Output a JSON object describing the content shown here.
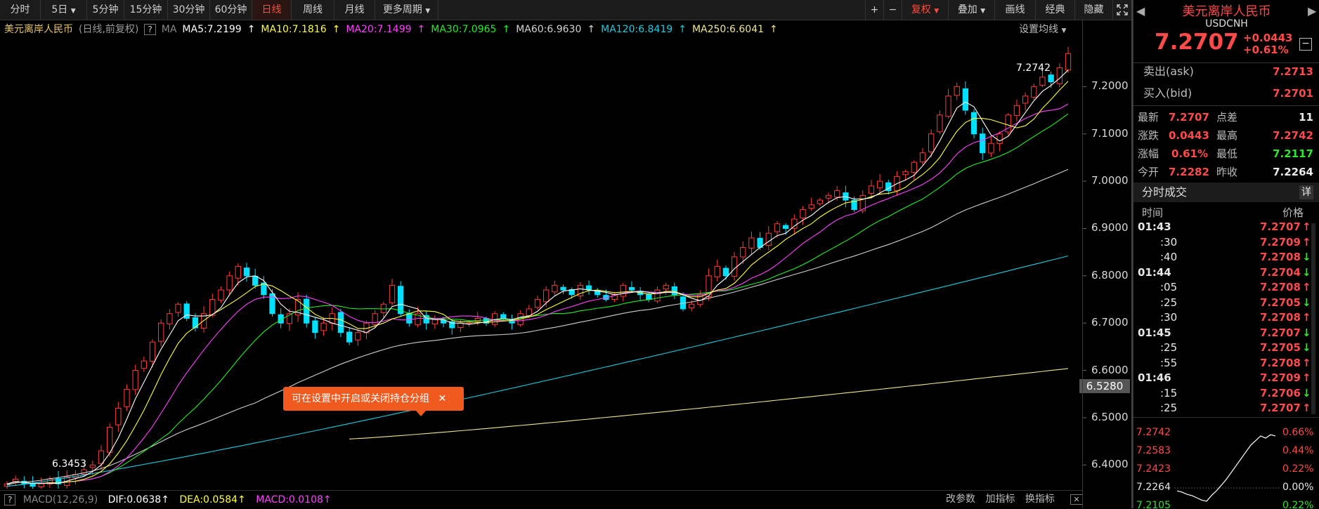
{
  "toolbar": {
    "tabs": [
      "分时",
      "5日",
      "5分钟",
      "15分钟",
      "30分钟",
      "60分钟",
      "日线",
      "周线",
      "月线",
      "更多周期"
    ],
    "active_tab": "日线",
    "right_buttons": [
      "复权",
      "叠加",
      "画线",
      "经典",
      "隐藏"
    ],
    "plus": "+",
    "minus": "−"
  },
  "ma_bar": {
    "title": "美元离岸人民币",
    "subtitle": "(日线,前复权)",
    "help": "?",
    "ma_label": "MA",
    "ma5": "MA5:7.2199",
    "ma10": "MA10:7.1816",
    "ma20": "MA20:7.1499",
    "ma30": "MA30:7.0965",
    "ma60": "MA60:6.9630",
    "ma120": "MA120:6.8419",
    "ma250": "MA250:6.6041",
    "settings": "设置均线"
  },
  "tooltip": {
    "text": "可在设置中开启或关闭持仓分组",
    "close": "✕"
  },
  "chart_data": {
    "type": "candlestick",
    "ylim": [
      6.35,
      7.3
    ],
    "yticks": [
      "7.2000",
      "7.1000",
      "7.0000",
      "6.9000",
      "6.8000",
      "6.7000",
      "6.6000",
      "6.5000",
      "6.4000"
    ],
    "yticks_val": [
      7.2,
      7.1,
      7.0,
      6.9,
      6.8,
      6.7,
      6.6,
      6.5,
      6.4
    ],
    "current_price_label": "6.5280",
    "high_annot": "7.2742",
    "low_annot": "6.3453",
    "colors": {
      "up": "#ff3b3b",
      "down": "#00e0ff",
      "ma5": "#ffffff",
      "ma10": "#ffff3a",
      "ma20": "#ff40ff",
      "ma30": "#22ee22",
      "ma60": "#cfcfcf",
      "ma120": "#1ecbe1",
      "ma250": "#f0e68c"
    },
    "closes": [
      6.36,
      6.37,
      6.36,
      6.355,
      6.36,
      6.37,
      6.36,
      6.375,
      6.38,
      6.39,
      6.4,
      6.43,
      6.48,
      6.52,
      6.56,
      6.6,
      6.62,
      6.66,
      6.7,
      6.72,
      6.74,
      6.71,
      6.69,
      6.72,
      6.75,
      6.77,
      6.8,
      6.82,
      6.8,
      6.78,
      6.76,
      6.72,
      6.7,
      6.72,
      6.75,
      6.7,
      6.68,
      6.7,
      6.72,
      6.68,
      6.66,
      6.68,
      6.7,
      6.72,
      6.74,
      6.78,
      6.72,
      6.7,
      6.72,
      6.7,
      6.71,
      6.7,
      6.69,
      6.7,
      6.7,
      6.71,
      6.7,
      6.72,
      6.71,
      6.7,
      6.72,
      6.73,
      6.75,
      6.77,
      6.78,
      6.77,
      6.76,
      6.78,
      6.77,
      6.76,
      6.75,
      6.76,
      6.78,
      6.77,
      6.76,
      6.75,
      6.77,
      6.78,
      6.76,
      6.73,
      6.74,
      6.76,
      6.8,
      6.82,
      6.8,
      6.84,
      6.86,
      6.88,
      6.86,
      6.89,
      6.91,
      6.9,
      6.92,
      6.94,
      6.95,
      6.96,
      6.97,
      6.98,
      6.96,
      6.94,
      6.97,
      6.99,
      7.0,
      6.98,
      7.01,
      7.02,
      7.04,
      7.06,
      7.1,
      7.14,
      7.18,
      7.2,
      7.15,
      7.1,
      7.06,
      7.08,
      7.1,
      7.14,
      7.16,
      7.18,
      7.2,
      7.22,
      7.21,
      7.24,
      7.27
    ]
  },
  "macd_bar": {
    "help": "?",
    "label": "MACD(12,26,9)",
    "dif": "DIF:0.0638",
    "dea": "DEA:0.0584",
    "macd": "MACD:0.0108",
    "buttons": [
      "改参数",
      "加指标",
      "换指标"
    ]
  },
  "quote": {
    "name": "美元离岸人民币",
    "code": "USDCNH",
    "price": "7.2707",
    "change": "+0.0443",
    "change_pct": "+0.61%",
    "ask_label": "卖出(ask)",
    "ask": "7.2713",
    "bid_label": "买入(bid)",
    "bid": "7.2701",
    "stats": [
      {
        "l1": "最新",
        "v1": "7.2707",
        "c1": "red",
        "l2": "点差",
        "v2": "11",
        "c2": "white"
      },
      {
        "l1": "涨跌",
        "v1": "0.0443",
        "c1": "red",
        "l2": "最高",
        "v2": "7.2742",
        "c2": "red"
      },
      {
        "l1": "涨幅",
        "v1": "0.61%",
        "c1": "red",
        "l2": "最低",
        "v2": "7.2117",
        "c2": "green"
      },
      {
        "l1": "今开",
        "v1": "7.2282",
        "c1": "red",
        "l2": "昨收",
        "v2": "7.2264",
        "c2": "white"
      }
    ]
  },
  "ticks": {
    "title": "分时成交",
    "detail": "详",
    "col_time": "时间",
    "col_price": "价格",
    "rows": [
      {
        "t": "01:43",
        "p": "7.2707",
        "d": "↑",
        "bold": true
      },
      {
        "t": ":30",
        "p": "7.2709",
        "d": "↑",
        "bold": false
      },
      {
        "t": ":40",
        "p": "7.2708",
        "d": "↓",
        "bold": false
      },
      {
        "t": "01:44",
        "p": "7.2704",
        "d": "↓",
        "bold": true
      },
      {
        "t": ":05",
        "p": "7.2708",
        "d": "↑",
        "bold": false
      },
      {
        "t": ":25",
        "p": "7.2705",
        "d": "↓",
        "bold": false
      },
      {
        "t": ":30",
        "p": "7.2708",
        "d": "↑",
        "bold": false
      },
      {
        "t": "01:45",
        "p": "7.2707",
        "d": "↓",
        "bold": true
      },
      {
        "t": ":25",
        "p": "7.2705",
        "d": "↓",
        "bold": false
      },
      {
        "t": ":55",
        "p": "7.2708",
        "d": "↑",
        "bold": false
      },
      {
        "t": "01:46",
        "p": "7.2709",
        "d": "↑",
        "bold": true
      },
      {
        "t": ":15",
        "p": "7.2706",
        "d": "↓",
        "bold": false
      },
      {
        "t": ":25",
        "p": "7.2707",
        "d": "↑",
        "bold": false
      }
    ]
  },
  "mini": {
    "left_labels": [
      "7.2742",
      "7.2583",
      "7.2423",
      "7.2264",
      "7.2105"
    ],
    "right_labels": [
      "0.66%",
      "0.44%",
      "0.22%",
      "0.00%",
      "0.22%"
    ],
    "values": [
      7.222,
      7.221,
      7.219,
      7.218,
      7.216,
      7.214,
      7.213,
      7.218,
      7.222,
      7.227,
      7.232,
      7.238,
      7.244,
      7.25,
      7.256,
      7.262,
      7.266,
      7.27,
      7.268,
      7.271,
      7.27
    ]
  }
}
